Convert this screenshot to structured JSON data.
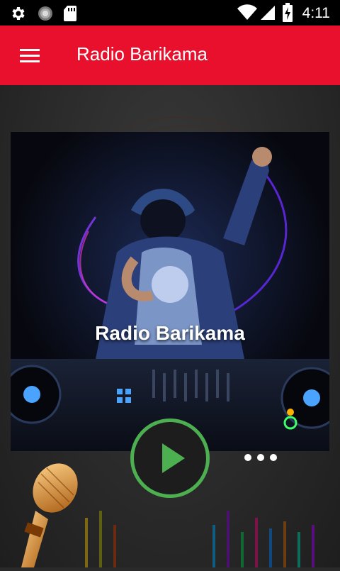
{
  "status_bar": {
    "time": "4:11",
    "icons": [
      "settings-gear-icon",
      "circle-icon",
      "sd-card-icon",
      "wifi-icon",
      "signal-icon",
      "battery-charging-icon"
    ]
  },
  "app_bar": {
    "title": "Radio Barikama",
    "menu_icon": "hamburger-menu-icon",
    "color": "#e8102c"
  },
  "hero": {
    "station_name": "Radio Barikama"
  },
  "player": {
    "play_icon": "play-icon",
    "accent": "#4caf50"
  },
  "pager": {
    "dot_count": 3
  }
}
